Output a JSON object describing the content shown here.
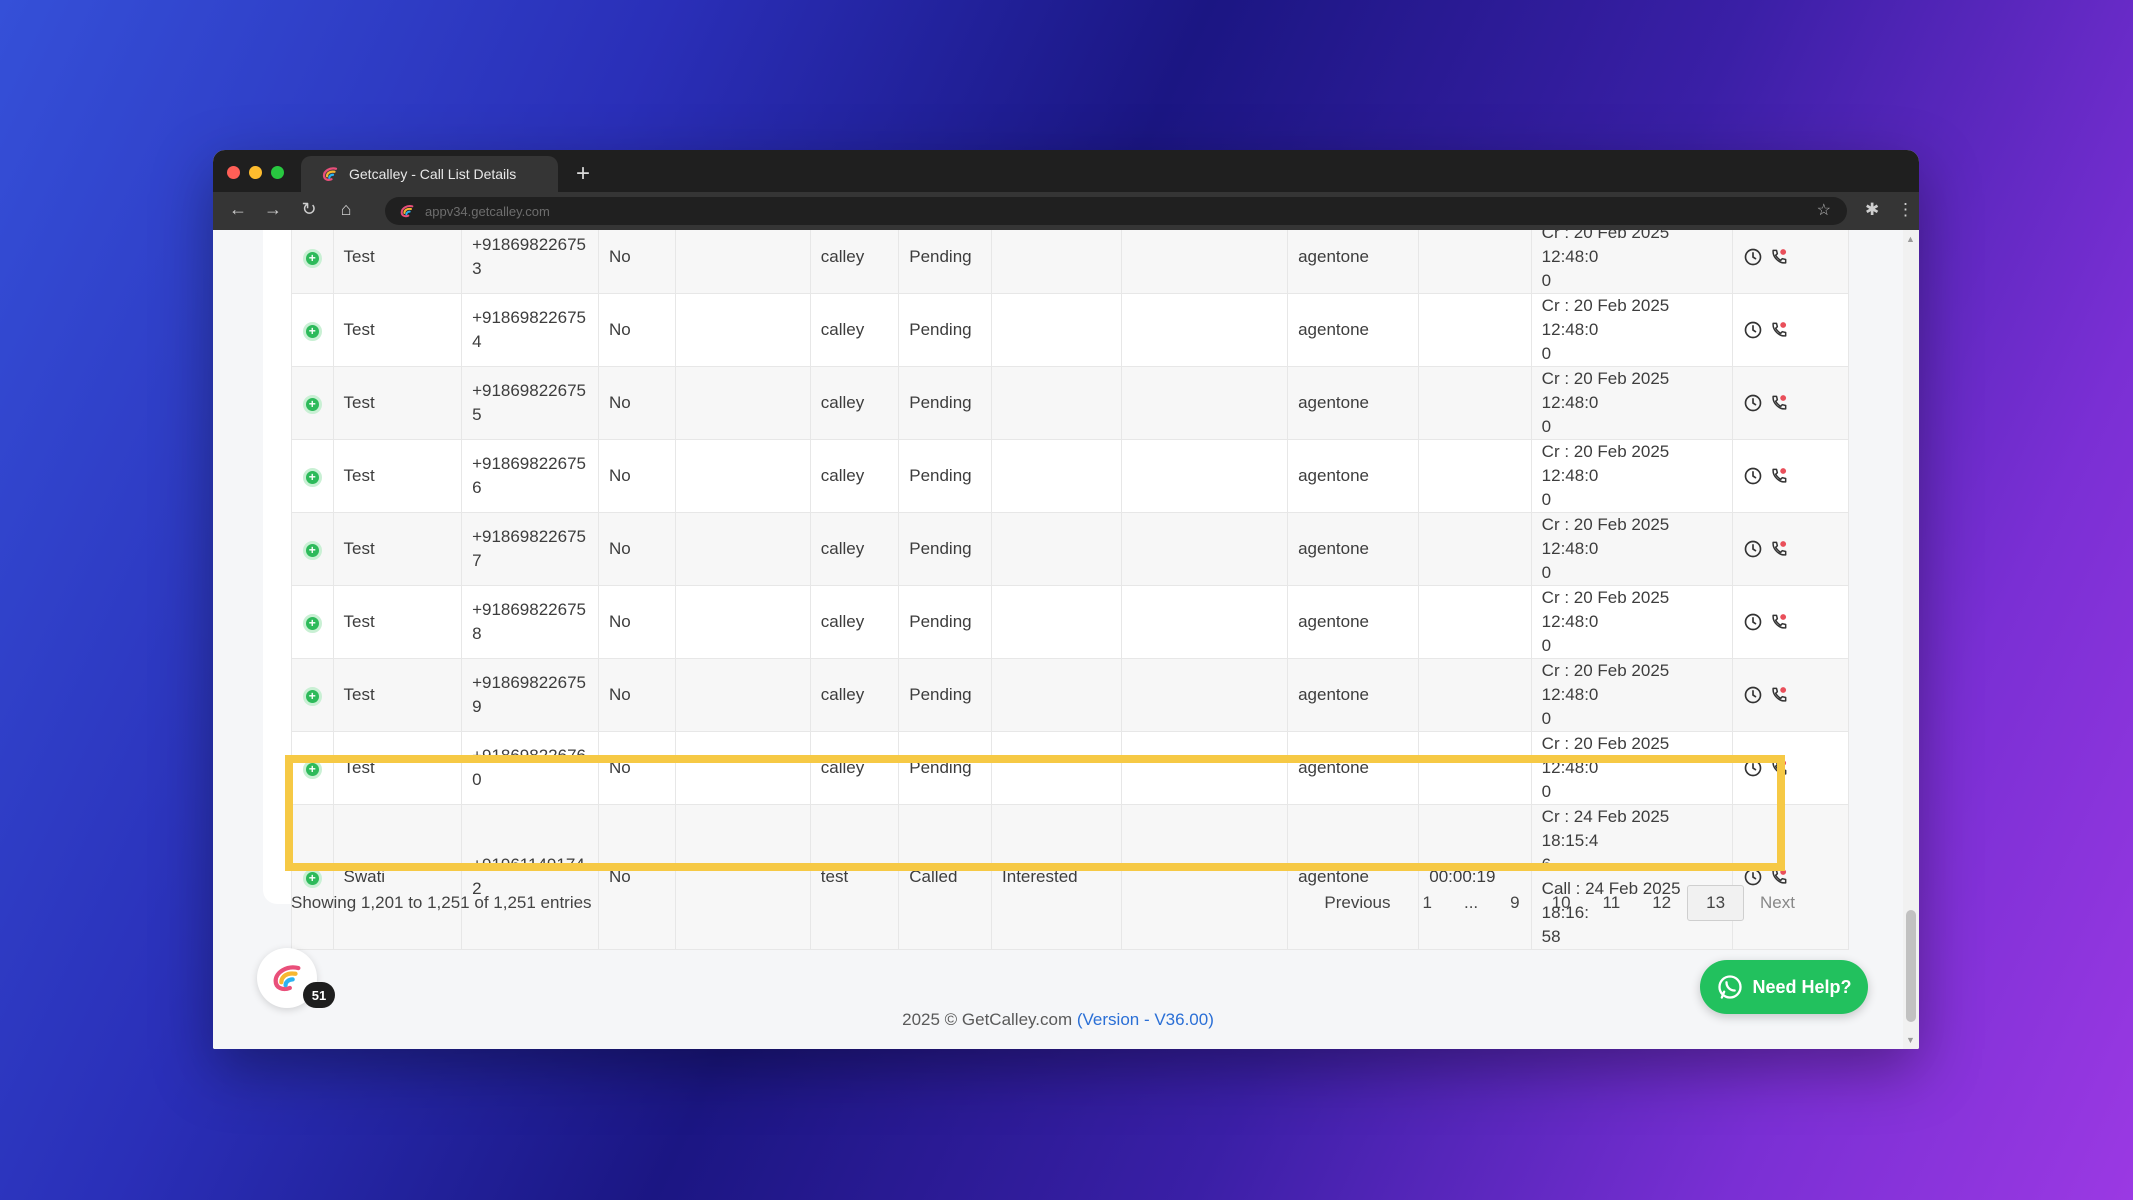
{
  "browser": {
    "tab_title": "Getcalley - Call List Details",
    "new_tab": "+",
    "url": "appv34.getcalley.com"
  },
  "colors": {
    "accent_green": "#2dba5a",
    "highlight": "#f6c945",
    "help_button": "#22c15e",
    "link_blue": "#2a6fd6",
    "traffic_red": "#ff5f57",
    "traffic_yellow": "#febc2e",
    "traffic_green": "#28c840"
  },
  "icons": {
    "expand": "plus-circle-icon",
    "history": "clock-icon",
    "call": "phone-call-icon"
  },
  "table": {
    "rows": [
      {
        "name": "Test",
        "phone_a": "+91869822675",
        "phone_b": "3",
        "flag": "No",
        "list": "calley",
        "status": "Pending",
        "result": "",
        "agent": "agentone",
        "duration": "",
        "date_a": "Cr : 20 Feb 2025 12:48:0",
        "date_b": "0"
      },
      {
        "name": "Test",
        "phone_a": "+91869822675",
        "phone_b": "4",
        "flag": "No",
        "list": "calley",
        "status": "Pending",
        "result": "",
        "agent": "agentone",
        "duration": "",
        "date_a": "Cr : 20 Feb 2025 12:48:0",
        "date_b": "0"
      },
      {
        "name": "Test",
        "phone_a": "+91869822675",
        "phone_b": "5",
        "flag": "No",
        "list": "calley",
        "status": "Pending",
        "result": "",
        "agent": "agentone",
        "duration": "",
        "date_a": "Cr : 20 Feb 2025 12:48:0",
        "date_b": "0"
      },
      {
        "name": "Test",
        "phone_a": "+91869822675",
        "phone_b": "6",
        "flag": "No",
        "list": "calley",
        "status": "Pending",
        "result": "",
        "agent": "agentone",
        "duration": "",
        "date_a": "Cr : 20 Feb 2025 12:48:0",
        "date_b": "0"
      },
      {
        "name": "Test",
        "phone_a": "+91869822675",
        "phone_b": "7",
        "flag": "No",
        "list": "calley",
        "status": "Pending",
        "result": "",
        "agent": "agentone",
        "duration": "",
        "date_a": "Cr : 20 Feb 2025 12:48:0",
        "date_b": "0"
      },
      {
        "name": "Test",
        "phone_a": "+91869822675",
        "phone_b": "8",
        "flag": "No",
        "list": "calley",
        "status": "Pending",
        "result": "",
        "agent": "agentone",
        "duration": "",
        "date_a": "Cr : 20 Feb 2025 12:48:0",
        "date_b": "0"
      },
      {
        "name": "Test",
        "phone_a": "+91869822675",
        "phone_b": "9",
        "flag": "No",
        "list": "calley",
        "status": "Pending",
        "result": "",
        "agent": "agentone",
        "duration": "",
        "date_a": "Cr : 20 Feb 2025 12:48:0",
        "date_b": "0"
      },
      {
        "name": "Test",
        "phone_a": "+91869822676",
        "phone_b": "0",
        "flag": "No",
        "list": "calley",
        "status": "Pending",
        "result": "",
        "agent": "agentone",
        "duration": "",
        "date_a": "Cr : 20 Feb 2025 12:48:0",
        "date_b": "0"
      }
    ],
    "highlighted": {
      "name": "Swati",
      "phone_a": "+91961149174",
      "phone_b": "2",
      "flag": "No",
      "list": "test",
      "status": "Called",
      "result": "Interested",
      "agent": "agentone",
      "duration": "00:00:19",
      "date_a": "Cr : 24 Feb 2025 18:15:4",
      "date_b": "6",
      "date_c": "Call : 24 Feb 2025 18:16:",
      "date_d": "58"
    }
  },
  "pagination": {
    "summary": "Showing 1,201 to 1,251 of 1,251 entries",
    "previous": "Previous",
    "pages": [
      "1",
      "...",
      "9",
      "10",
      "11",
      "12",
      "13"
    ],
    "current": "13",
    "next": "Next"
  },
  "widget": {
    "badge_count": "51",
    "help_label": "Need Help?"
  },
  "footer": {
    "copyright": "2025 © GetCalley.com",
    "version": "(Version - V36.00)"
  }
}
